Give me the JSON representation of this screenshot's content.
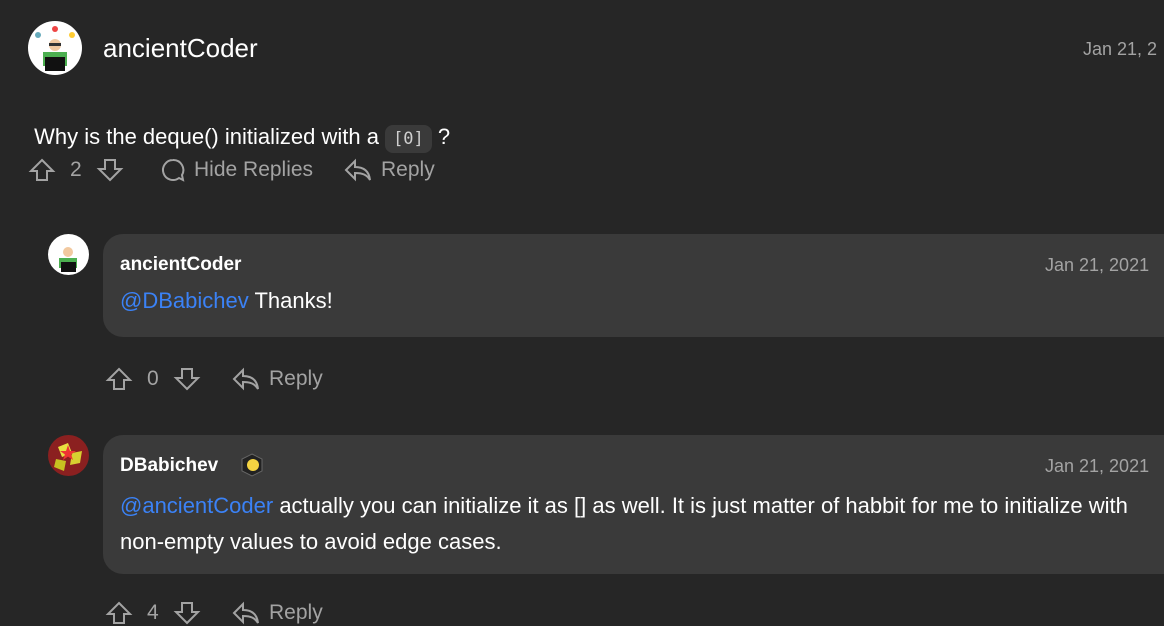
{
  "comment": {
    "author": "ancientCoder",
    "date": "Jan 21, 2",
    "text_before": "Why is the deque() initialized with a ",
    "code": "[0]",
    "text_after": " ?",
    "votes": "2",
    "hide_replies": "Hide Replies",
    "reply": "Reply"
  },
  "replies": [
    {
      "author": "ancientCoder",
      "date": "Jan 21, 2021",
      "mention": "@DBabichev",
      "text": " Thanks!",
      "votes": "0",
      "reply": "Reply"
    },
    {
      "author": "DBabichev",
      "date": "Jan 21, 2021",
      "mention": "@ancientCoder",
      "text": " actually you can initialize it as [] as well. It is just matter of habbit for me to initialize with non-empty values to avoid edge cases.",
      "votes": "4",
      "reply": "Reply"
    }
  ],
  "colors": {
    "background": "#262626",
    "bubble": "#3a3a3a",
    "mention": "#3b82f6"
  }
}
